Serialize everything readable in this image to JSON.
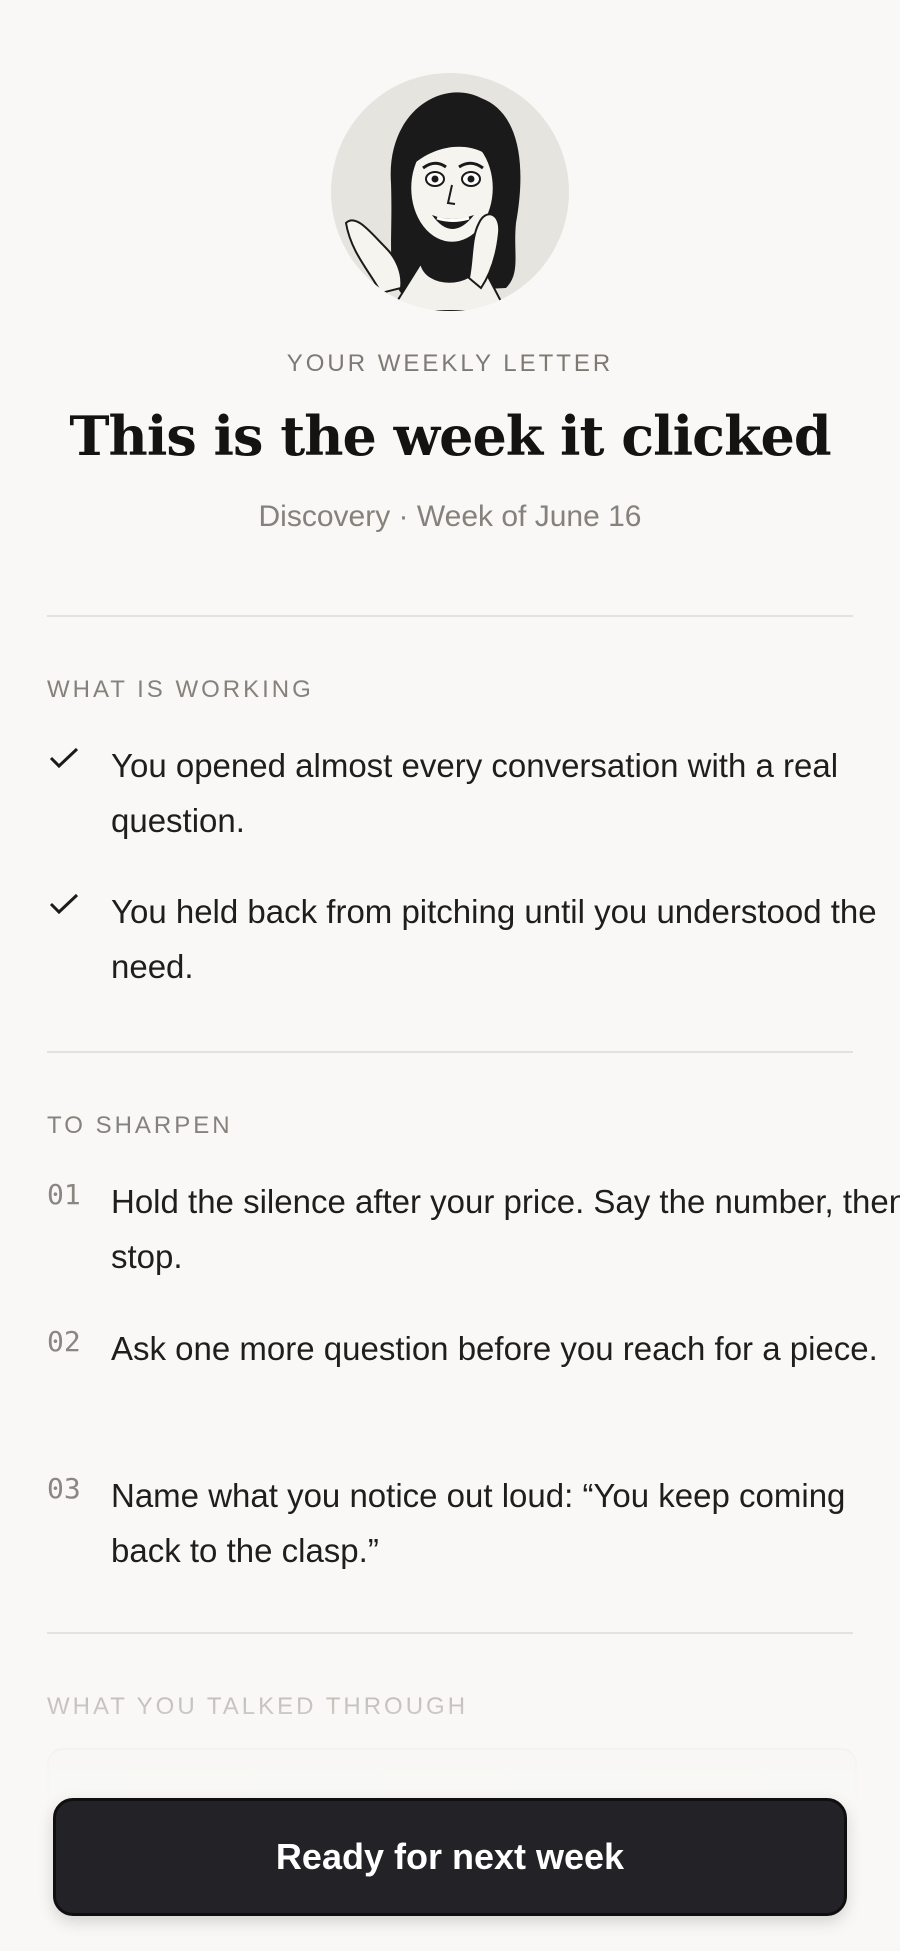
{
  "header": {
    "eyebrow": "YOUR WEEKLY LETTER",
    "title": "This is the week it clicked",
    "subtitle": "Discovery · Week of June 16"
  },
  "working": {
    "label": "WHAT IS WORKING",
    "items": [
      {
        "text": "You opened almost every conversation with a real question.",
        "icon": "check-icon"
      },
      {
        "text": "You held back from pitching until you understood the need.",
        "icon": "check-icon"
      }
    ]
  },
  "sharpen": {
    "label": "TO SHARPEN",
    "items": [
      {
        "num": "01",
        "text": "Hold the silence after your price. Say the number, then stop."
      },
      {
        "num": "02",
        "text": "Ask one more question before you reach for a piece."
      },
      {
        "num": "03",
        "text": "Name what you notice out loud: “You keep coming back to the clasp.”"
      }
    ]
  },
  "talked": {
    "label": "WHAT YOU TALKED THROUGH"
  },
  "cta": {
    "label": "Ready for next week"
  }
}
